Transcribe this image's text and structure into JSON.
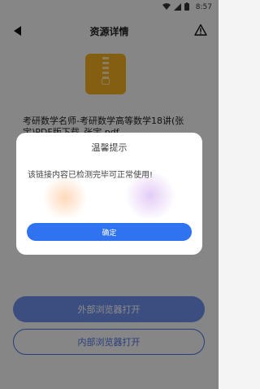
{
  "status_bar": {
    "time": "8:57"
  },
  "header": {
    "title": "资源详情"
  },
  "file": {
    "name": "考研数学名师-考研数学高等数学18讲(张宇)PDF版下载_张宇.pdf"
  },
  "buttons": {
    "open_external": "外部浏览器打开",
    "open_internal": "内部浏览器打开"
  },
  "dialog": {
    "title": "温馨提示",
    "message": "该链接内容已检测完毕可正常使用!",
    "confirm": "确定"
  },
  "colors": {
    "primary": "#2f73f0",
    "file_icon": "#f0ad1f"
  }
}
